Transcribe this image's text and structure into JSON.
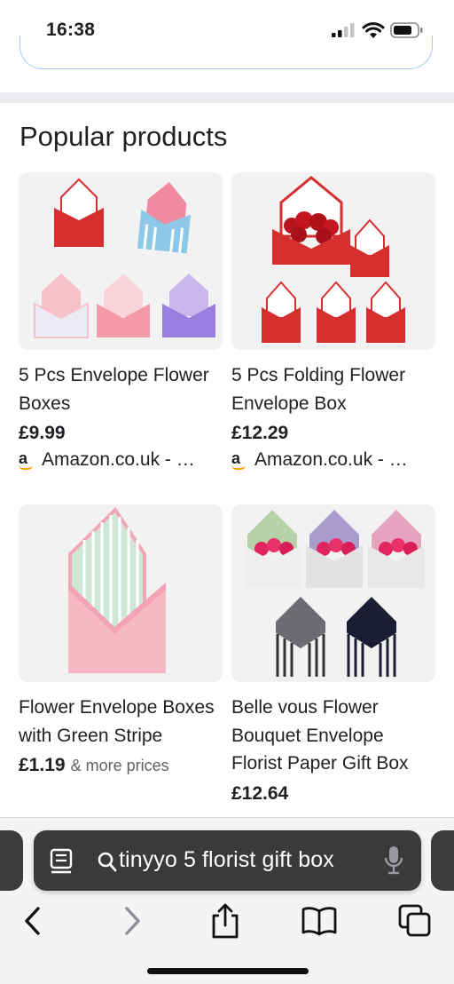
{
  "status_bar": {
    "time": "16:38"
  },
  "section": {
    "title": "Popular products"
  },
  "products": [
    {
      "title": "5 Pcs Envelope Flower Boxes",
      "price": "£9.99",
      "more": "",
      "seller": "Amazon.co.uk - …",
      "seller_logo": "a"
    },
    {
      "title": "5 Pcs Folding Flower Envelope Box",
      "price": "£12.29",
      "more": "",
      "seller": "Amazon.co.uk - …",
      "seller_logo": "a"
    },
    {
      "title": "Flower Envelope Boxes with Green Stripe",
      "price": "£1.19",
      "more": "& more prices",
      "seller": "",
      "seller_logo": ""
    },
    {
      "title": "Belle vous Flower Bouquet Envelope Florist Paper Gift Box",
      "price": "£12.64",
      "more": "",
      "seller": "",
      "seller_logo": ""
    }
  ],
  "browser": {
    "address_text": "tinyyo 5 florist gift box",
    "icons": [
      "reader-icon",
      "search-icon",
      "mic-icon",
      "back-icon",
      "forward-icon",
      "share-icon",
      "bookmarks-icon",
      "tabs-icon"
    ]
  },
  "colors": {
    "accent_blue": "#a8c7fa",
    "amazon_orange": "#ff9900",
    "envelope_red": "#d62f2f"
  }
}
